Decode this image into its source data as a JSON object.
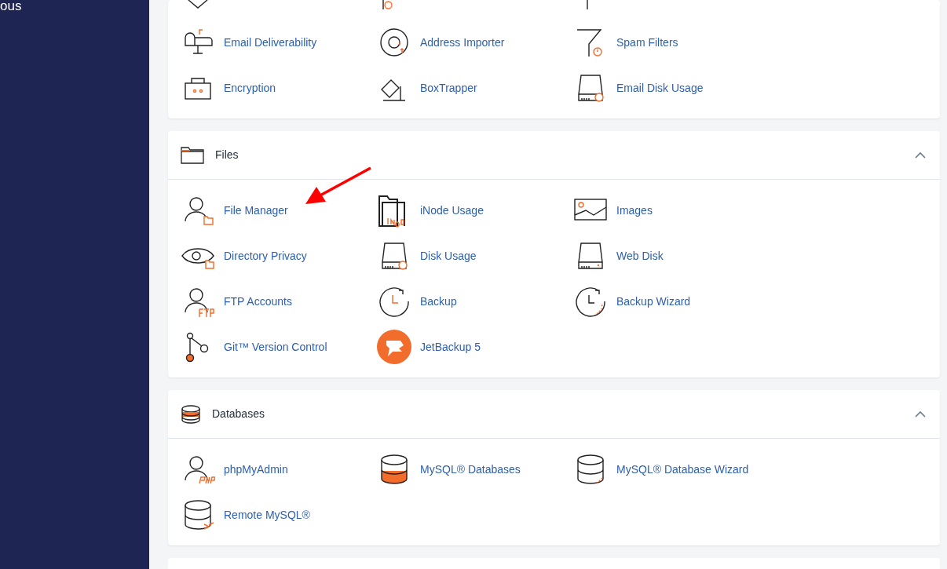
{
  "sidebar": {
    "text": "ous"
  },
  "sections": [
    {
      "items": [
        "Email Deliverability",
        "Address Importer",
        "Spam Filters",
        "Encryption",
        "BoxTrapper",
        "Email Disk Usage"
      ]
    },
    {
      "title": "Files",
      "expanded": true,
      "items": [
        "File Manager",
        "iNode Usage",
        "Images",
        "Directory Privacy",
        "Disk Usage",
        "Web Disk",
        "FTP Accounts",
        "Backup",
        "Backup Wizard",
        "Git™ Version Control",
        "JetBackup 5"
      ]
    },
    {
      "title": "Databases",
      "expanded": true,
      "items": [
        "phpMyAdmin",
        "MySQL® Databases",
        "MySQL® Database Wizard",
        "Remote MySQL®"
      ]
    }
  ]
}
